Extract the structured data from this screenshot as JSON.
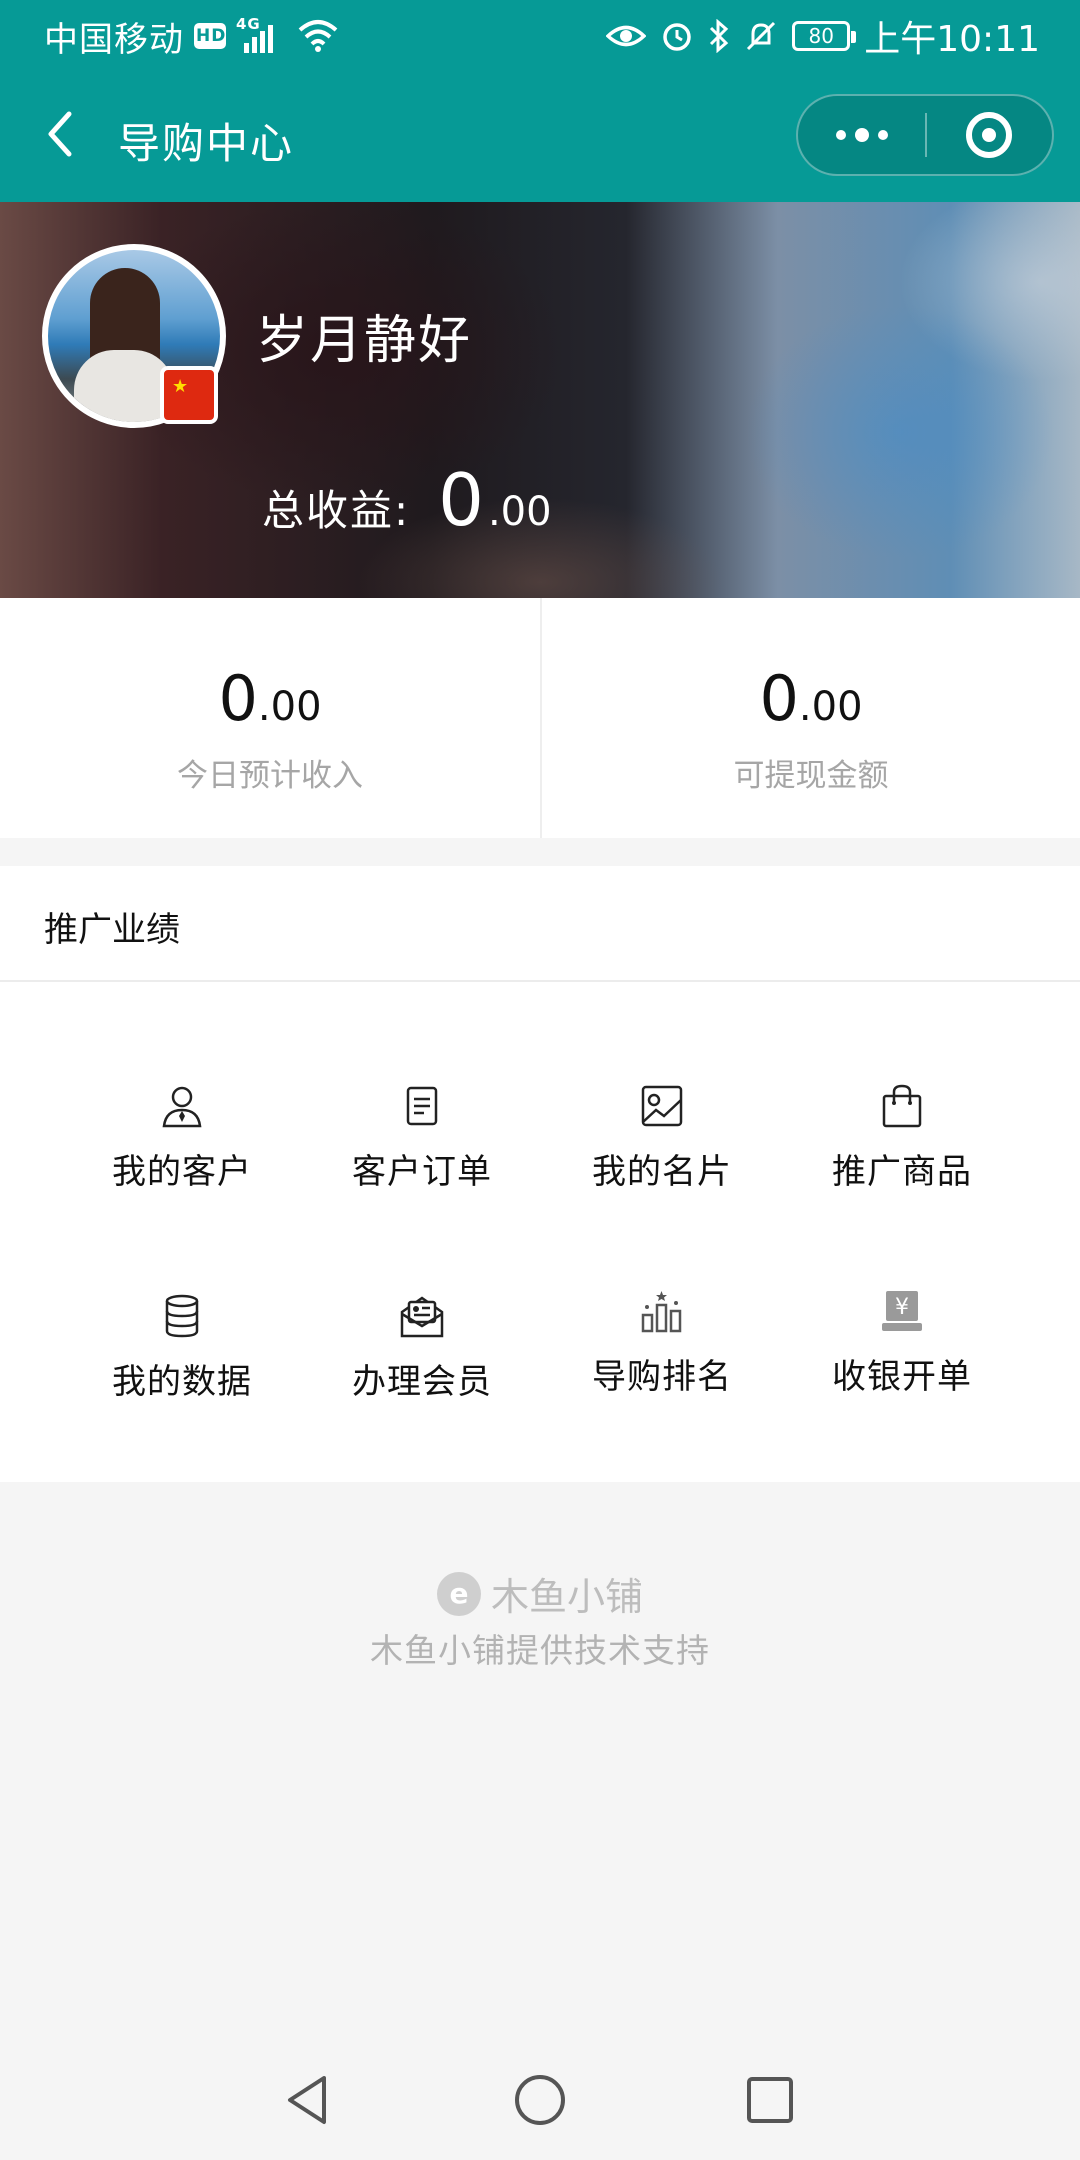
{
  "status_bar": {
    "carrier": "中国移动",
    "hd": "HD",
    "network": "4G",
    "battery": "80",
    "time": "上午10:11"
  },
  "nav": {
    "title": "导购中心"
  },
  "profile": {
    "name": "岁月静好",
    "total_earnings_label": "总收益:",
    "total_earnings_int": "0",
    "total_earnings_dec": ".00"
  },
  "stats": [
    {
      "int": "0",
      "dec": ".00",
      "label": "今日预计收入"
    },
    {
      "int": "0",
      "dec": ".00",
      "label": "可提现金额"
    }
  ],
  "promo": {
    "title": "推广业绩",
    "items": [
      {
        "label": "我的客户",
        "icon": "customer-icon"
      },
      {
        "label": "客户订单",
        "icon": "order-icon"
      },
      {
        "label": "我的名片",
        "icon": "business-card-icon"
      },
      {
        "label": "推广商品",
        "icon": "shopping-bag-icon"
      },
      {
        "label": "我的数据",
        "icon": "database-icon"
      },
      {
        "label": "办理会员",
        "icon": "membership-icon"
      },
      {
        "label": "导购排名",
        "icon": "ranking-icon"
      },
      {
        "label": "收银开单",
        "icon": "cashier-icon"
      }
    ]
  },
  "footer": {
    "brand": "木鱼小铺",
    "support": "木鱼小铺提供技术支持"
  },
  "colors": {
    "header_bg": "#069a96",
    "page_bg": "#f5f5f5"
  }
}
